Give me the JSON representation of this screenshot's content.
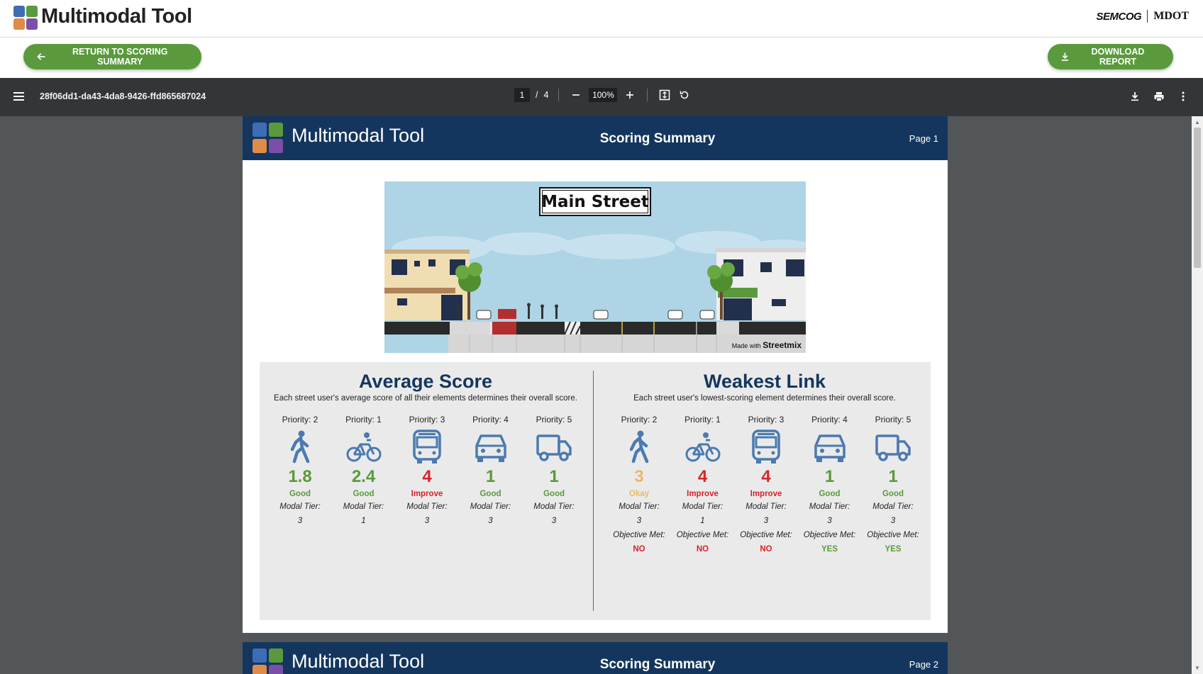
{
  "app": {
    "title": "Multimodal Tool",
    "partners": [
      "SEMCOG",
      "MDOT"
    ]
  },
  "actions": {
    "return_label": "RETURN TO SCORING SUMMARY",
    "download_label": "DOWNLOAD REPORT"
  },
  "viewer": {
    "filename": "28f06dd1-da43-4da8-9426-ffd865687024",
    "current_page": "1",
    "page_sep": "/",
    "total_pages": "4",
    "zoom": "100%"
  },
  "report": {
    "header_title": "Multimodal Tool",
    "section_title": "Scoring Summary",
    "page1_label": "Page 1",
    "page2_label": "Page 2",
    "street_name": "Main Street",
    "made_with": "Made with",
    "made_with_brand": "Streetmix"
  },
  "average": {
    "title": "Average Score",
    "description": "Each street user's average score of all their elements determines their overall score.",
    "tier_label": "Modal Tier:",
    "modes": [
      {
        "mode": "pedestrian-icon",
        "priority": "Priority: 2",
        "score": "1.8",
        "rating": "Good",
        "tier": "3"
      },
      {
        "mode": "bicycle-icon",
        "priority": "Priority: 1",
        "score": "2.4",
        "rating": "Good",
        "tier": "1"
      },
      {
        "mode": "bus-icon",
        "priority": "Priority: 3",
        "score": "4",
        "rating": "Improve",
        "tier": "3"
      },
      {
        "mode": "car-icon",
        "priority": "Priority: 4",
        "score": "1",
        "rating": "Good",
        "tier": "3"
      },
      {
        "mode": "truck-icon",
        "priority": "Priority: 5",
        "score": "1",
        "rating": "Good",
        "tier": "3"
      }
    ]
  },
  "weakest": {
    "title": "Weakest Link",
    "description": "Each street user's lowest-scoring element determines their overall score.",
    "tier_label": "Modal Tier:",
    "objective_label": "Objective Met:",
    "modes": [
      {
        "mode": "pedestrian-icon",
        "priority": "Priority: 2",
        "score": "3",
        "rating": "Okay",
        "tier": "3",
        "objective": "NO"
      },
      {
        "mode": "bicycle-icon",
        "priority": "Priority: 1",
        "score": "4",
        "rating": "Improve",
        "tier": "1",
        "objective": "NO"
      },
      {
        "mode": "bus-icon",
        "priority": "Priority: 3",
        "score": "4",
        "rating": "Improve",
        "tier": "3",
        "objective": "NO"
      },
      {
        "mode": "car-icon",
        "priority": "Priority: 4",
        "score": "1",
        "rating": "Good",
        "tier": "3",
        "objective": "YES"
      },
      {
        "mode": "truck-icon",
        "priority": "Priority: 5",
        "score": "1",
        "rating": "Good",
        "tier": "3",
        "objective": "YES"
      }
    ]
  },
  "colors": {
    "good": "#5a9a3c",
    "okay": "#e8b96a",
    "improve": "#d8232a",
    "navy": "#14365e",
    "icon": "#4a7ab0",
    "brand_blue": "#3f6db5",
    "brand_green": "#5a9a3c",
    "brand_orange": "#e08b4a",
    "brand_purple": "#7a4fa8"
  }
}
